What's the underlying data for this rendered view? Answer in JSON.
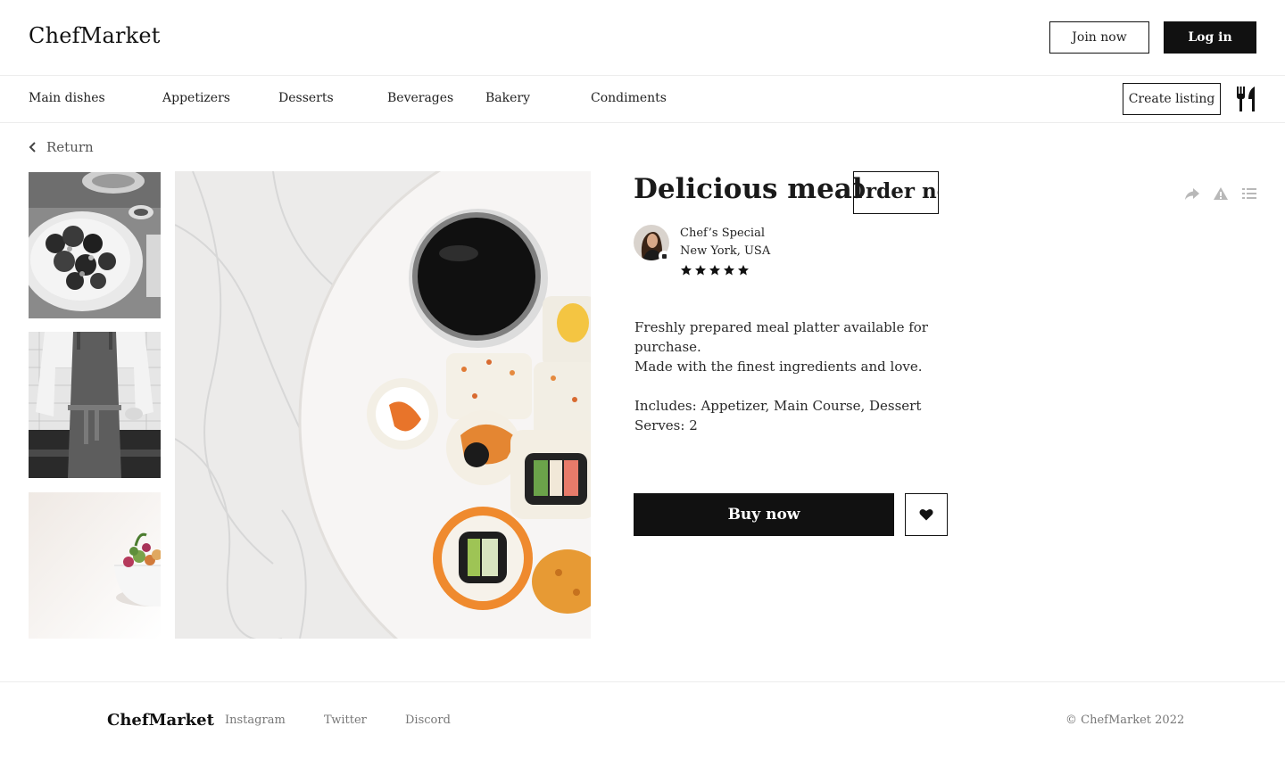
{
  "header": {
    "brand": "ChefMarket",
    "join_label": "Join now",
    "login_label": "Log in"
  },
  "nav": {
    "items": [
      {
        "label": "Main dishes"
      },
      {
        "label": "Appetizers"
      },
      {
        "label": "Desserts"
      },
      {
        "label": "Beverages"
      },
      {
        "label": "Bakery"
      },
      {
        "label": "Condiments"
      }
    ],
    "create_label": "Create listing",
    "menu_icon": "cutlery-icon"
  },
  "page": {
    "return_label": "Return",
    "return_icon": "chevron-left-icon"
  },
  "gallery": {
    "thumbnails": [
      {
        "alt": "plate-of-dumplings-photo"
      },
      {
        "alt": "chef-in-apron-photo"
      },
      {
        "alt": "salad-bowl-photo"
      }
    ],
    "main": {
      "alt": "sushi-platter-photo"
    }
  },
  "product": {
    "title": "Delicious meal",
    "order_label": "Order now",
    "actions": [
      "share-icon",
      "warning-icon",
      "list-icon"
    ],
    "chef": {
      "name": "Chef’s Special",
      "location": "New York, USA",
      "rating": 5,
      "rating_max": 5
    },
    "description": {
      "line1": "Freshly prepared meal platter available for purchase.",
      "line2": "Made with the finest ingredients and love.",
      "line3": "Includes: Appetizer, Main Course, Dessert",
      "line4": "Serves: 2"
    },
    "buy_label": "Buy now",
    "favorite_icon": "heart-icon"
  },
  "footer": {
    "brand": "ChefMarket",
    "links": [
      {
        "label": "Instagram"
      },
      {
        "label": "Twitter"
      },
      {
        "label": "Discord"
      }
    ],
    "copyright": "© ChefMarket 2022"
  },
  "colors": {
    "primary": "#111111",
    "border": "#ececec",
    "muted_text": "#777777",
    "background": "#ffffff"
  }
}
